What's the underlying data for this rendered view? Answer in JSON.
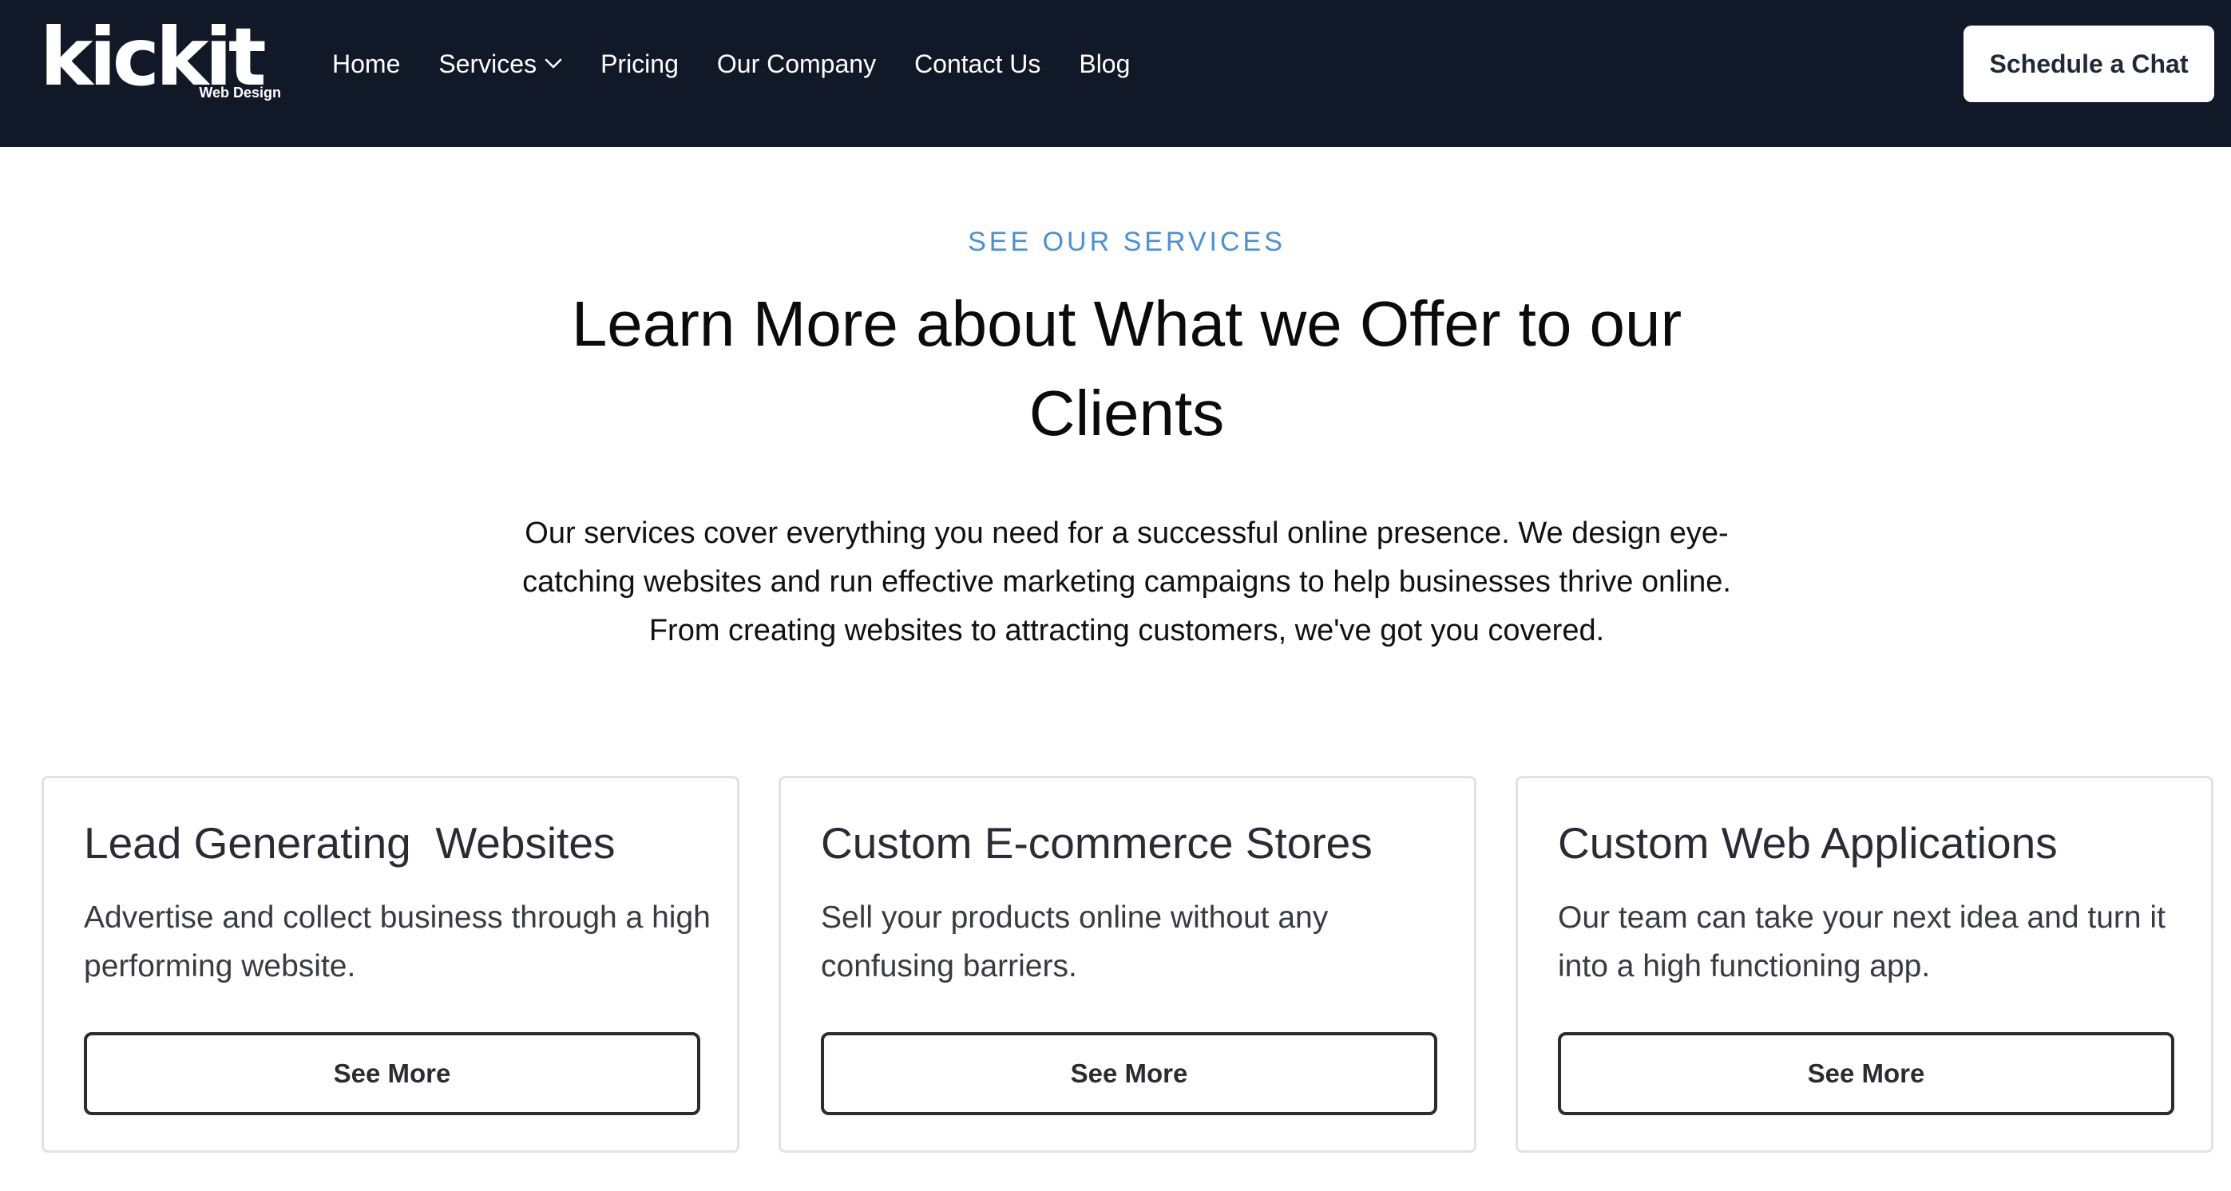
{
  "header": {
    "logo": {
      "word": "kickit",
      "subtitle": "Web Design"
    },
    "nav": [
      {
        "label": "Home"
      },
      {
        "label": "Services",
        "has_dropdown": true
      },
      {
        "label": "Pricing"
      },
      {
        "label": "Our Company"
      },
      {
        "label": "Contact Us"
      },
      {
        "label": "Blog"
      }
    ],
    "cta_label": "Schedule a Chat",
    "background_color": "#111827"
  },
  "intro": {
    "eyebrow": "SEE OUR SERVICES",
    "headline": "Learn More about What we Offer to our Clients",
    "description": "Our services cover everything you need for a successful online presence. We design eye-catching websites and run effective marketing campaigns to help businesses thrive online. From creating websites to attracting customers, we've got you covered.",
    "eyebrow_color": "#4a90d9"
  },
  "cards": [
    {
      "title": "Lead Generating  Websites",
      "description": "Advertise and collect business through a high performing website.",
      "button_label": "See More"
    },
    {
      "title": "Custom E-commerce Stores",
      "description": "Sell your products online without any confusing barriers.",
      "button_label": "See More"
    },
    {
      "title": "Custom Web Applications",
      "description": "Our team can take your next idea and turn it into a high functioning app.",
      "button_label": "See More"
    }
  ],
  "icons": {
    "services_dropdown": "chevron-down-icon"
  }
}
